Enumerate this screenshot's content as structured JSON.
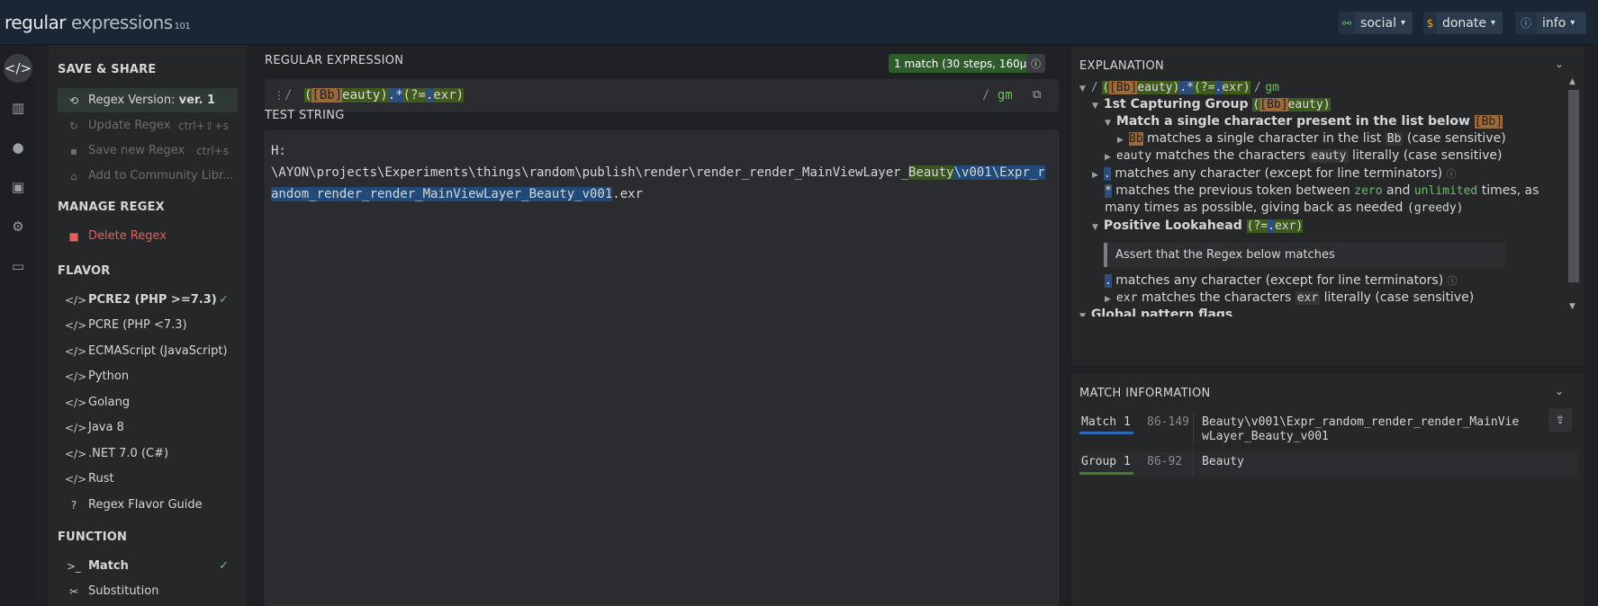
{
  "topbar": {
    "logo_main": "regular",
    "logo_light": " expressions",
    "logo_version": "101",
    "social_label": "social",
    "donate_label": "donate",
    "info_label": "info"
  },
  "sidebar": {
    "save_share": {
      "heading": "SAVE & SHARE",
      "regex_version_label": "Regex Version: ",
      "regex_version_value": "ver. 1",
      "update_regex": "Update Regex",
      "update_shortcut": "ctrl+⇧+s",
      "save_new_regex": "Save new Regex",
      "save_shortcut": "ctrl+s",
      "add_community": "Add to Community Libr..."
    },
    "manage": {
      "heading": "MANAGE REGEX",
      "delete": "Delete Regex"
    },
    "flavor": {
      "heading": "FLAVOR",
      "items": [
        "PCRE2 (PHP >=7.3)",
        "PCRE (PHP <7.3)",
        "ECMAScript (JavaScript)",
        "Python",
        "Golang",
        "Java 8",
        ".NET 7.0 (C#)",
        "Rust",
        "Regex Flavor Guide"
      ]
    },
    "function": {
      "heading": "FUNCTION",
      "items": [
        "Match",
        "Substitution"
      ]
    }
  },
  "main": {
    "regex_heading": "REGULAR EXPRESSION",
    "match_badge": "1 match (30 steps, 160µs)",
    "regex_delim_open": "/",
    "regex_flags_slash": "/",
    "regex_flags": "gm",
    "regex": {
      "p1": "(",
      "p2": "[Bb]",
      "p3": "eauty",
      "p4": ")",
      "p5": ".",
      "p6": "*",
      "p7": "(?=",
      "p8": ".",
      "p9": "exr",
      "p10": ")"
    },
    "test_heading": "TEST STRING",
    "test": {
      "pre": "H:\n\\AYON\\projects\\Experiments\\things\\random\\publish\\render\\render_render_MainViewLayer_",
      "group": "Beauty",
      "match_rest": "\\v001\\Expr_random_render_render_MainViewLayer_Beauty_v001",
      "post": ".exr"
    }
  },
  "explanation": {
    "heading": "EXPLANATION",
    "root_slash": "/",
    "root_flags": "gm",
    "root_end_slash": "/",
    "cap_group_label": "1st Capturing Group",
    "cap_group_code_open": "(",
    "cap_group_code_cls": "[Bb]",
    "cap_group_code_rest": "eauty",
    "cap_group_code_close": ")",
    "match_single_label": "Match a single character present in the list below",
    "match_single_code": "[Bb]",
    "bb_code": "Bb",
    "bb_text": "matches a single character in the list",
    "bb_text_code": "Bb",
    "bb_text_end": "(case sensitive)",
    "eauty_code": "eauty",
    "eauty_text": "matches the characters",
    "eauty_text_code": "eauty",
    "eauty_text_end": "literally (case sensitive)",
    "dot_code": ".",
    "dot_text": "matches any character (except for line terminators)",
    "star_code": "*",
    "star_text1": "matches the previous token between",
    "star_zero": "zero",
    "star_and": "and",
    "star_unlimited": "unlimited",
    "star_text2": "times, as",
    "star_text3": "many times as possible, giving back as needed",
    "star_greedy": "(greedy)",
    "lookahead_label": "Positive Lookahead",
    "lookahead_code_open": "(?=",
    "lookahead_code_dot": ".",
    "lookahead_code_rest": "exr)",
    "assert_text": "Assert that the Regex below matches",
    "dot2_code": ".",
    "dot2_text": "matches any character (except for line terminators)",
    "exr_code": "exr",
    "exr_text": "matches the characters",
    "exr_text_code": "exr",
    "exr_text_end": "literally (case sensitive)",
    "global_flags": "Global pattern flags"
  },
  "match_info": {
    "heading": "MATCH INFORMATION",
    "rows": [
      {
        "name": "Match 1",
        "range": "86-149",
        "value": "Beauty\\v001\\Expr_random_render_render_MainViewLayer_Beauty_v001"
      },
      {
        "name": "Group 1",
        "range": "86-92",
        "value": "Beauty"
      }
    ]
  },
  "colors": {
    "topbar_bg": "#1b2634",
    "match_blue": "#204a7a",
    "group_green": "#3a5420",
    "char_class": "#9c6a3a"
  }
}
